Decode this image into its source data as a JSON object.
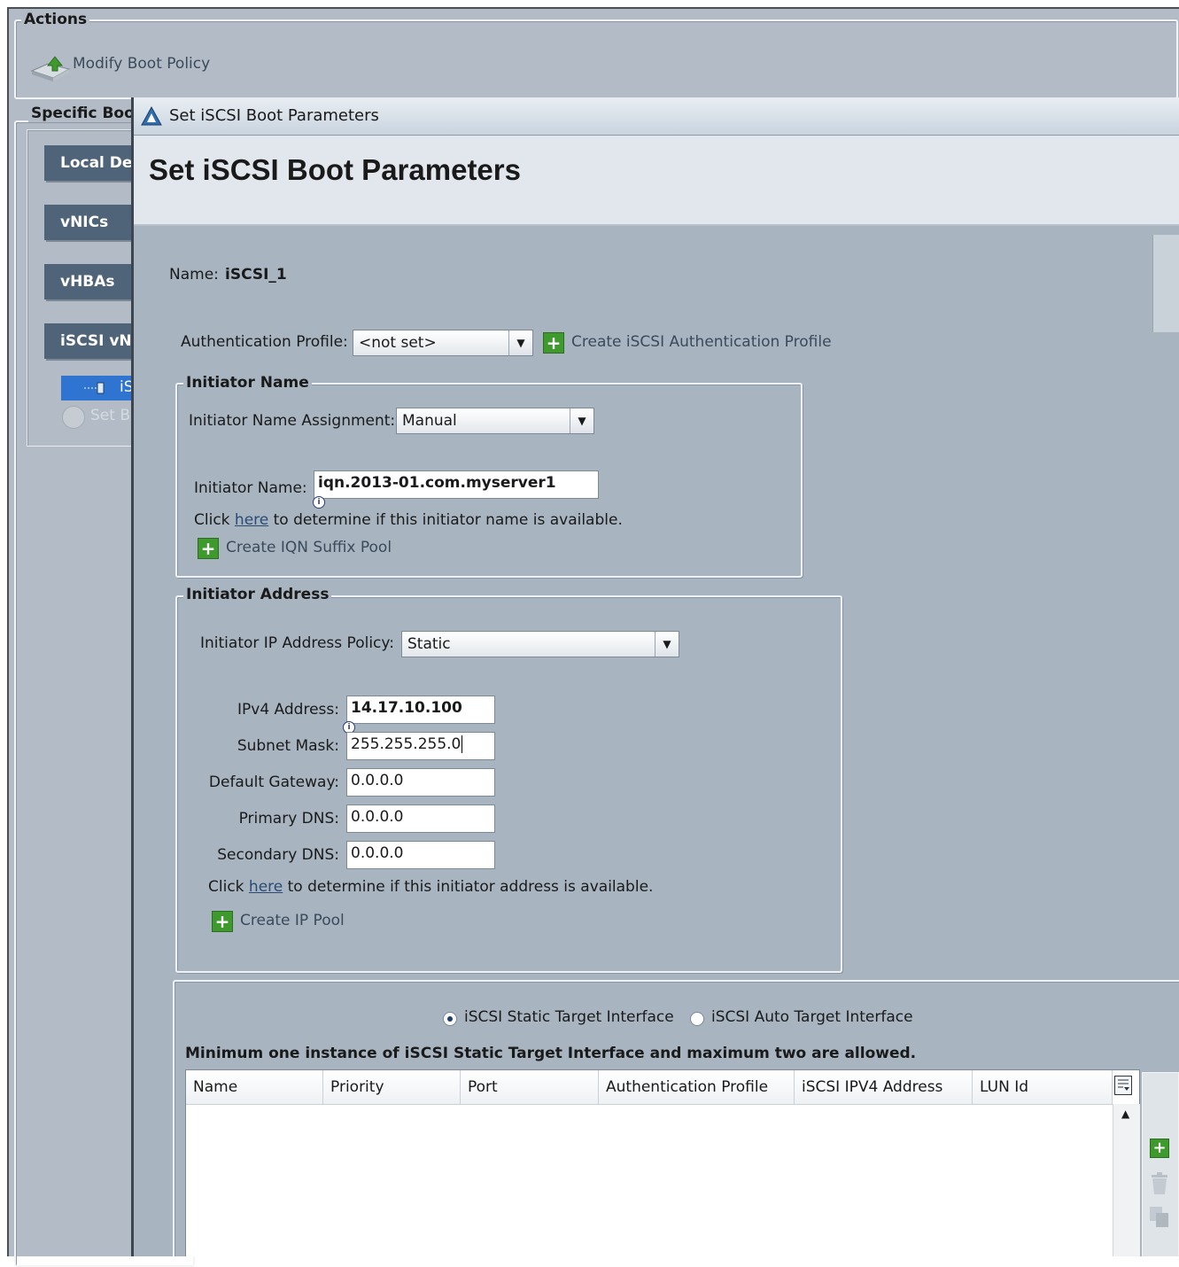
{
  "actions": {
    "legend": "Actions",
    "modify_label": "Modify Boot Policy"
  },
  "boot_order": {
    "legend": "Specific Boo",
    "buttons": [
      "Local De",
      "vNICs",
      "vHBAs",
      "iSCSI vN"
    ],
    "tree_item": "iS",
    "set_item": "Set B"
  },
  "dialog": {
    "window_title": "Set iSCSI Boot Parameters",
    "heading": "Set iSCSI Boot Parameters",
    "name_label": "Name:",
    "name_value": "iSCSI_1",
    "auth_profile_label": "Authentication Profile:",
    "auth_profile_value": "<not set>",
    "create_auth_profile": "Create iSCSI Authentication Profile",
    "initiator_name": {
      "legend": "Initiator Name",
      "assignment_label": "Initiator Name Assignment:",
      "assignment_value": "Manual",
      "name_label": "Initiator Name:",
      "name_value": "iqn.2013-01.com.myserver1",
      "click_prefix": "Click",
      "here": "here",
      "click_suffix": "to determine if this initiator name is available.",
      "create_pool": "Create IQN Suffix Pool"
    },
    "initiator_address": {
      "legend": "Initiator Address",
      "policy_label": "Initiator IP Address Policy:",
      "policy_value": "Static",
      "ipv4_label": "IPv4 Address:",
      "ipv4_value": "14.17.10.100",
      "subnet_label": "Subnet Mask:",
      "subnet_value": "255.255.255.0",
      "gateway_label": "Default Gateway:",
      "gateway_value": "0.0.0.0",
      "primary_dns_label": "Primary DNS:",
      "primary_dns_value": "0.0.0.0",
      "secondary_dns_label": "Secondary DNS:",
      "secondary_dns_value": "0.0.0.0",
      "click_prefix": "Click",
      "here": "here",
      "click_suffix": "to determine if this initiator address is available.",
      "create_pool": "Create IP Pool"
    },
    "target": {
      "static_label": "iSCSI Static Target Interface",
      "auto_label": "iSCSI Auto Target Interface",
      "selected": "static",
      "note": "Minimum one instance of iSCSI Static Target Interface and maximum two are allowed.",
      "columns": [
        "Name",
        "Priority",
        "Port",
        "Authentication Profile",
        "iSCSI IPV4 Address",
        "LUN Id"
      ]
    }
  },
  "colors": {
    "background": "#b3bcc6",
    "dialog": "#a8b5c1",
    "side_button": "#4f6379",
    "selected_item": "#2f74d0",
    "add_green": "#3e9a2c"
  }
}
